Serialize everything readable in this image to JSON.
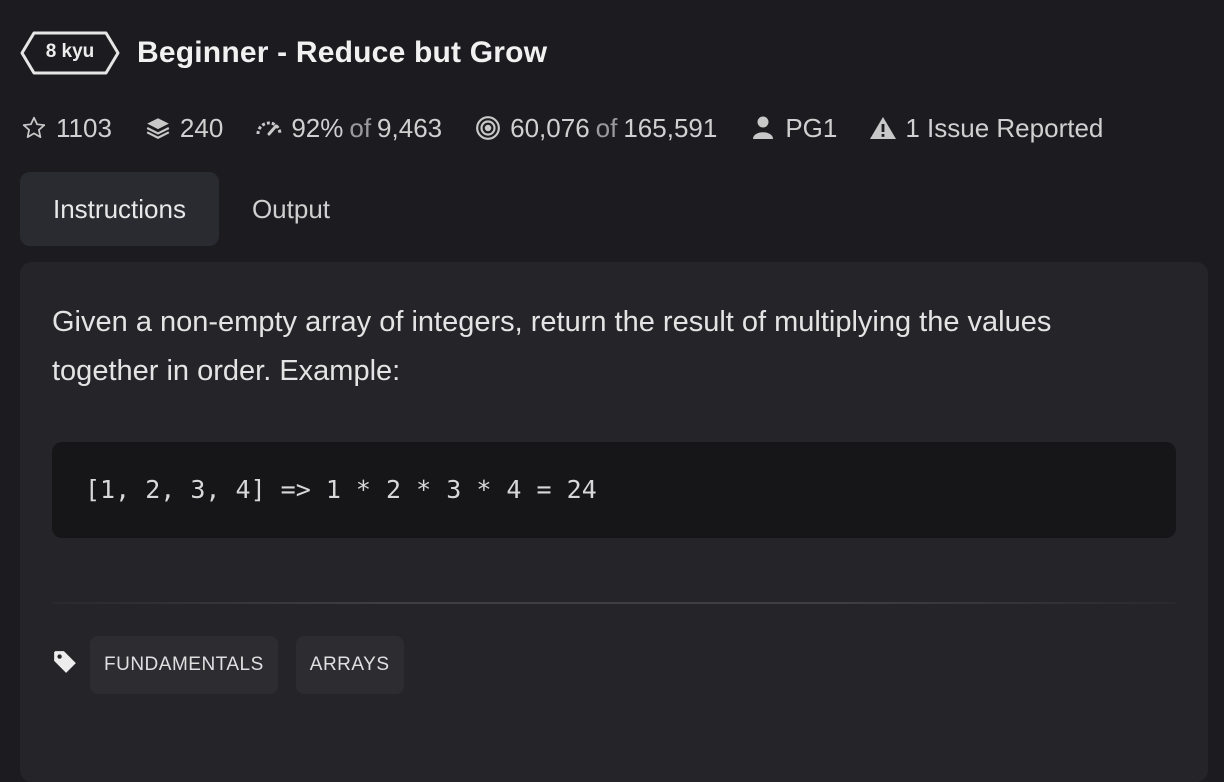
{
  "kata": {
    "rank": "8 kyu",
    "title": "Beginner - Reduce but Grow"
  },
  "stats": {
    "stars": "1103",
    "collections": "240",
    "satisfaction_percent": "92%",
    "satisfaction_of": "of",
    "satisfaction_votes": "9,463",
    "completed": "60,076",
    "completed_of": "of",
    "attempted": "165,591",
    "author": "PG1",
    "issues": "1 Issue Reported"
  },
  "icons": {
    "stars": "star-outline-icon",
    "collections": "layers-icon",
    "satisfaction": "gauge-icon",
    "completion": "target-icon",
    "author": "user-icon",
    "issues": "warning-icon",
    "tags": "tag-icon"
  },
  "tabs": [
    {
      "label": "Instructions",
      "active": true
    },
    {
      "label": "Output",
      "active": false
    }
  ],
  "description": {
    "text": "Given a non-empty array of integers, return the result of multiplying the values together in order. Example:",
    "code": "[1, 2, 3, 4] => 1 * 2 * 3 * 4 = 24"
  },
  "tags": [
    "FUNDAMENTALS",
    "ARRAYS"
  ],
  "colors": {
    "background": "#1c1c20",
    "panel": "#252529",
    "code_background": "#161618",
    "active_tab": "#2a2b31",
    "tag_background": "#2c2c31",
    "text": "#e6e6e6",
    "muted_text": "#9a9a9e"
  }
}
